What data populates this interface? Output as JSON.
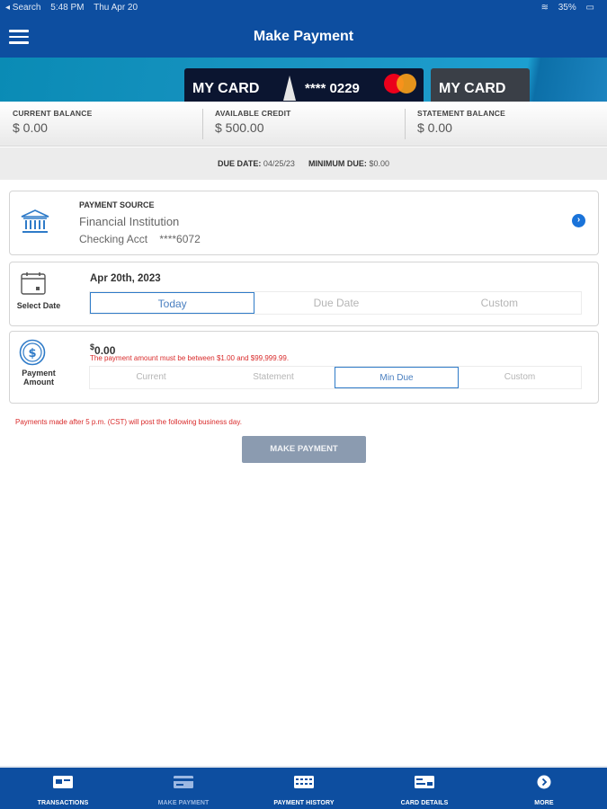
{
  "status_bar": {
    "back_label": "◂ Search",
    "time": "5:48 PM",
    "date": "Thu Apr 20",
    "battery": "35%"
  },
  "header": {
    "title": "Make Payment"
  },
  "cards": [
    {
      "name": "MY CARD",
      "number": "**** 0229"
    },
    {
      "name": "MY CARD"
    }
  ],
  "balances": [
    {
      "label": "CURRENT BALANCE",
      "value": "$ 0.00"
    },
    {
      "label": "AVAILABLE CREDIT",
      "value": "$ 500.00"
    },
    {
      "label": "STATEMENT BALANCE",
      "value": "$ 0.00"
    }
  ],
  "due": {
    "due_date_label": "DUE DATE:",
    "due_date": "04/25/23",
    "min_due_label": "MINIMUM DUE:",
    "min_due": "$0.00"
  },
  "payment_source": {
    "label": "PAYMENT SOURCE",
    "institution": "Financial Institution",
    "account": "Checking Acct    ****6072"
  },
  "select_date": {
    "label": "Select Date",
    "value": "Apr 20th, 2023",
    "options": [
      "Today",
      "Due Date",
      "Custom"
    ],
    "selected": "Today"
  },
  "payment_amount": {
    "label_line1": "Payment",
    "label_line2": "Amount",
    "currency": "$",
    "value": "0.00",
    "error": "The payment amount must be between $1.00 and $99,999.99.",
    "options": [
      "Current",
      "Statement",
      "Min Due",
      "Custom"
    ],
    "selected": "Min Due"
  },
  "notice": "Payments made after 5 p.m. (CST) will post the following business day.",
  "make_payment_button": "MAKE PAYMENT",
  "tabs": [
    {
      "label": "TRANSACTIONS",
      "icon": "transactions-icon"
    },
    {
      "label": "MAKE PAYMENT",
      "icon": "make-payment-icon",
      "active": true
    },
    {
      "label": "PAYMENT HISTORY",
      "icon": "payment-history-icon"
    },
    {
      "label": "CARD DETAILS",
      "icon": "card-details-icon"
    },
    {
      "label": "MORE",
      "icon": "more-icon"
    }
  ],
  "colors": {
    "primary": "#0d4ea0",
    "accent": "#2f7bc8",
    "error": "#d92b2b",
    "button_disabled": "#8b9bb0"
  }
}
